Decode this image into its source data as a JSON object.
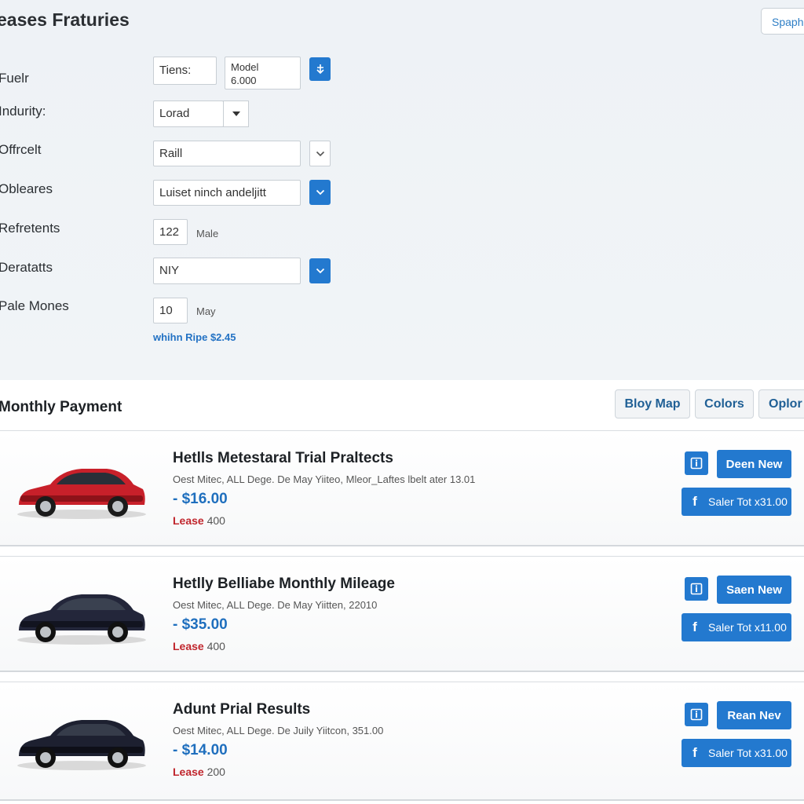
{
  "header": {
    "title": "eases Fraturies",
    "search_label": "Spaph"
  },
  "form": {
    "rows": [
      {
        "label": "Fuelr",
        "field1": "Tiens:",
        "field2_line1": "Model",
        "field2_line2": "6.000"
      },
      {
        "label": "Indurity:",
        "value": "Lorad"
      },
      {
        "label": "Offrcelt",
        "value": "Raill"
      },
      {
        "label": "Obleares",
        "value": "Luiset ninch andeljitt"
      },
      {
        "label": "Refretents",
        "value": "122",
        "unit": "Male"
      },
      {
        "label": "Deratatts",
        "value": "NIY"
      },
      {
        "label": "Pale Mones",
        "value": "10",
        "unit": "May"
      }
    ],
    "note": "whihn Ripe $2.45"
  },
  "results": {
    "title": "Monthly Payment",
    "tabs": [
      "Bloy Map",
      "Colors",
      "Oplor"
    ]
  },
  "listings": [
    {
      "title": "Hetlls Metestaral Trial Praltects",
      "subtitle": "Oest Mitec, ALL Dege. De May Yiiteo, Mleor_Laftes lbelt ater 13.01",
      "price": "$16.00",
      "lease_label": "Lease",
      "lease_value": "400",
      "action": "Deen New",
      "share": "Saler Tot x31.00",
      "car_color": "#c8202a",
      "car_dark": "#8e1219"
    },
    {
      "title": "Hetlly Belliabe Monthly Mileage",
      "subtitle": "Oest Mitec, ALL Dege. De May Yiitten, 22010",
      "price": "$35.00",
      "lease_label": "Lease",
      "lease_value": "400",
      "action": "Saen New",
      "share": "Saler Tot x11.00",
      "car_color": "#23263a",
      "car_dark": "#121420"
    },
    {
      "title": "Adunt Prial Results",
      "subtitle": "Oest Mitec, ALL Dege. De Juily Yiitcon, 351.00",
      "price": "$14.00",
      "lease_label": "Lease",
      "lease_value": "200",
      "action": "Rean Nev",
      "share": "Saler Tot x31.00",
      "car_color": "#1d2030",
      "car_dark": "#0e0f18"
    }
  ],
  "colors": {
    "accent": "#2379cf",
    "price": "#1f6fbe",
    "lease": "#c0262d"
  },
  "icons": {
    "info": "info-square-icon",
    "share": "facebook-icon",
    "caret": "chevron-down-icon",
    "arrow": "arrow-down-icon"
  }
}
